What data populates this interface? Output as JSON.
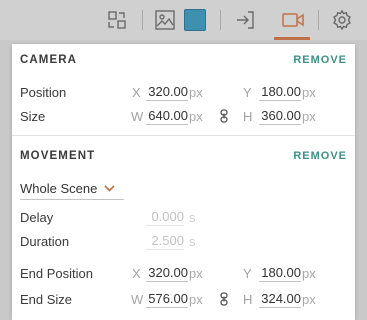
{
  "toolbar": {
    "icons": [
      "swap-layout-icon",
      "image-icon",
      "color-swatch-icon",
      "enter-icon",
      "camera-icon",
      "gear-icon"
    ],
    "active_color": "#c07046",
    "swatch_color": "#3f8fae"
  },
  "camera": {
    "title": "CAMERA",
    "remove_label": "REMOVE",
    "position": {
      "label": "Position",
      "x_axis": "X",
      "x": "320.00",
      "y_axis": "Y",
      "y": "180.00",
      "unit": "px"
    },
    "size": {
      "label": "Size",
      "w_axis": "W",
      "w": "640.00",
      "h_axis": "H",
      "h": "360.00",
      "unit": "px"
    }
  },
  "movement": {
    "title": "MOVEMENT",
    "remove_label": "REMOVE",
    "target_select": "Whole Scene",
    "delay": {
      "label": "Delay",
      "value": "0.000",
      "unit": "s"
    },
    "duration": {
      "label": "Duration",
      "value": "2.500",
      "unit": "s"
    },
    "end_position": {
      "label": "End Position",
      "x_axis": "X",
      "x": "320.00",
      "y_axis": "Y",
      "y": "180.00",
      "unit": "px"
    },
    "end_size": {
      "label": "End Size",
      "w_axis": "W",
      "w": "576.00",
      "h_axis": "H",
      "h": "324.00",
      "unit": "px"
    }
  },
  "colors": {
    "accent": "#3f8f8a",
    "dropdown_chevron": "#c07046"
  }
}
